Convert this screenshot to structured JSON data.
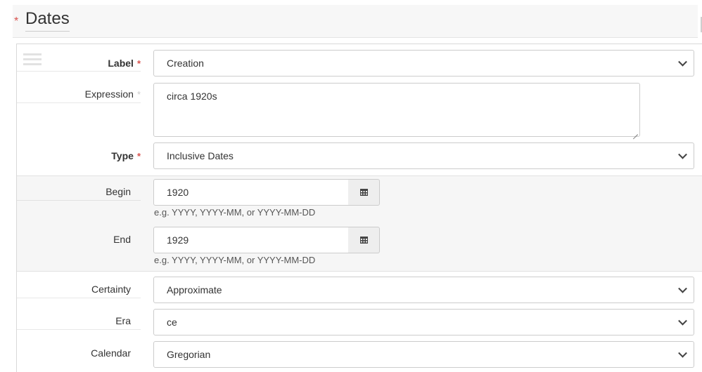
{
  "section": {
    "title": "Dates",
    "required_mark": "*"
  },
  "fields": {
    "label": {
      "label": "Label",
      "required_mark": "*",
      "value": "Creation"
    },
    "expression": {
      "label": "Expression",
      "required_mark": "*",
      "value": "circa 1920s"
    },
    "type": {
      "label": "Type",
      "required_mark": "*",
      "value": "Inclusive Dates"
    },
    "begin": {
      "label": "Begin",
      "value": "1920",
      "hint": "e.g. YYYY, YYYY-MM, or YYYY-MM-DD"
    },
    "end": {
      "label": "End",
      "value": "1929",
      "hint": "e.g. YYYY, YYYY-MM, or YYYY-MM-DD"
    },
    "certainty": {
      "label": "Certainty",
      "value": "Approximate"
    },
    "era": {
      "label": "Era",
      "value": "ce"
    },
    "calendar": {
      "label": "Calendar",
      "value": "Gregorian"
    }
  },
  "icons": {
    "select": "chevron-down-icon",
    "date": "calendar-icon",
    "drag": "drag-handle-icon",
    "resize": "resize-grip-icon"
  },
  "colors": {
    "required": "#d9534f",
    "required_soft": "#cccccc",
    "header_bg": "#f7f7f7",
    "group_bg": "#f6f6f6"
  }
}
